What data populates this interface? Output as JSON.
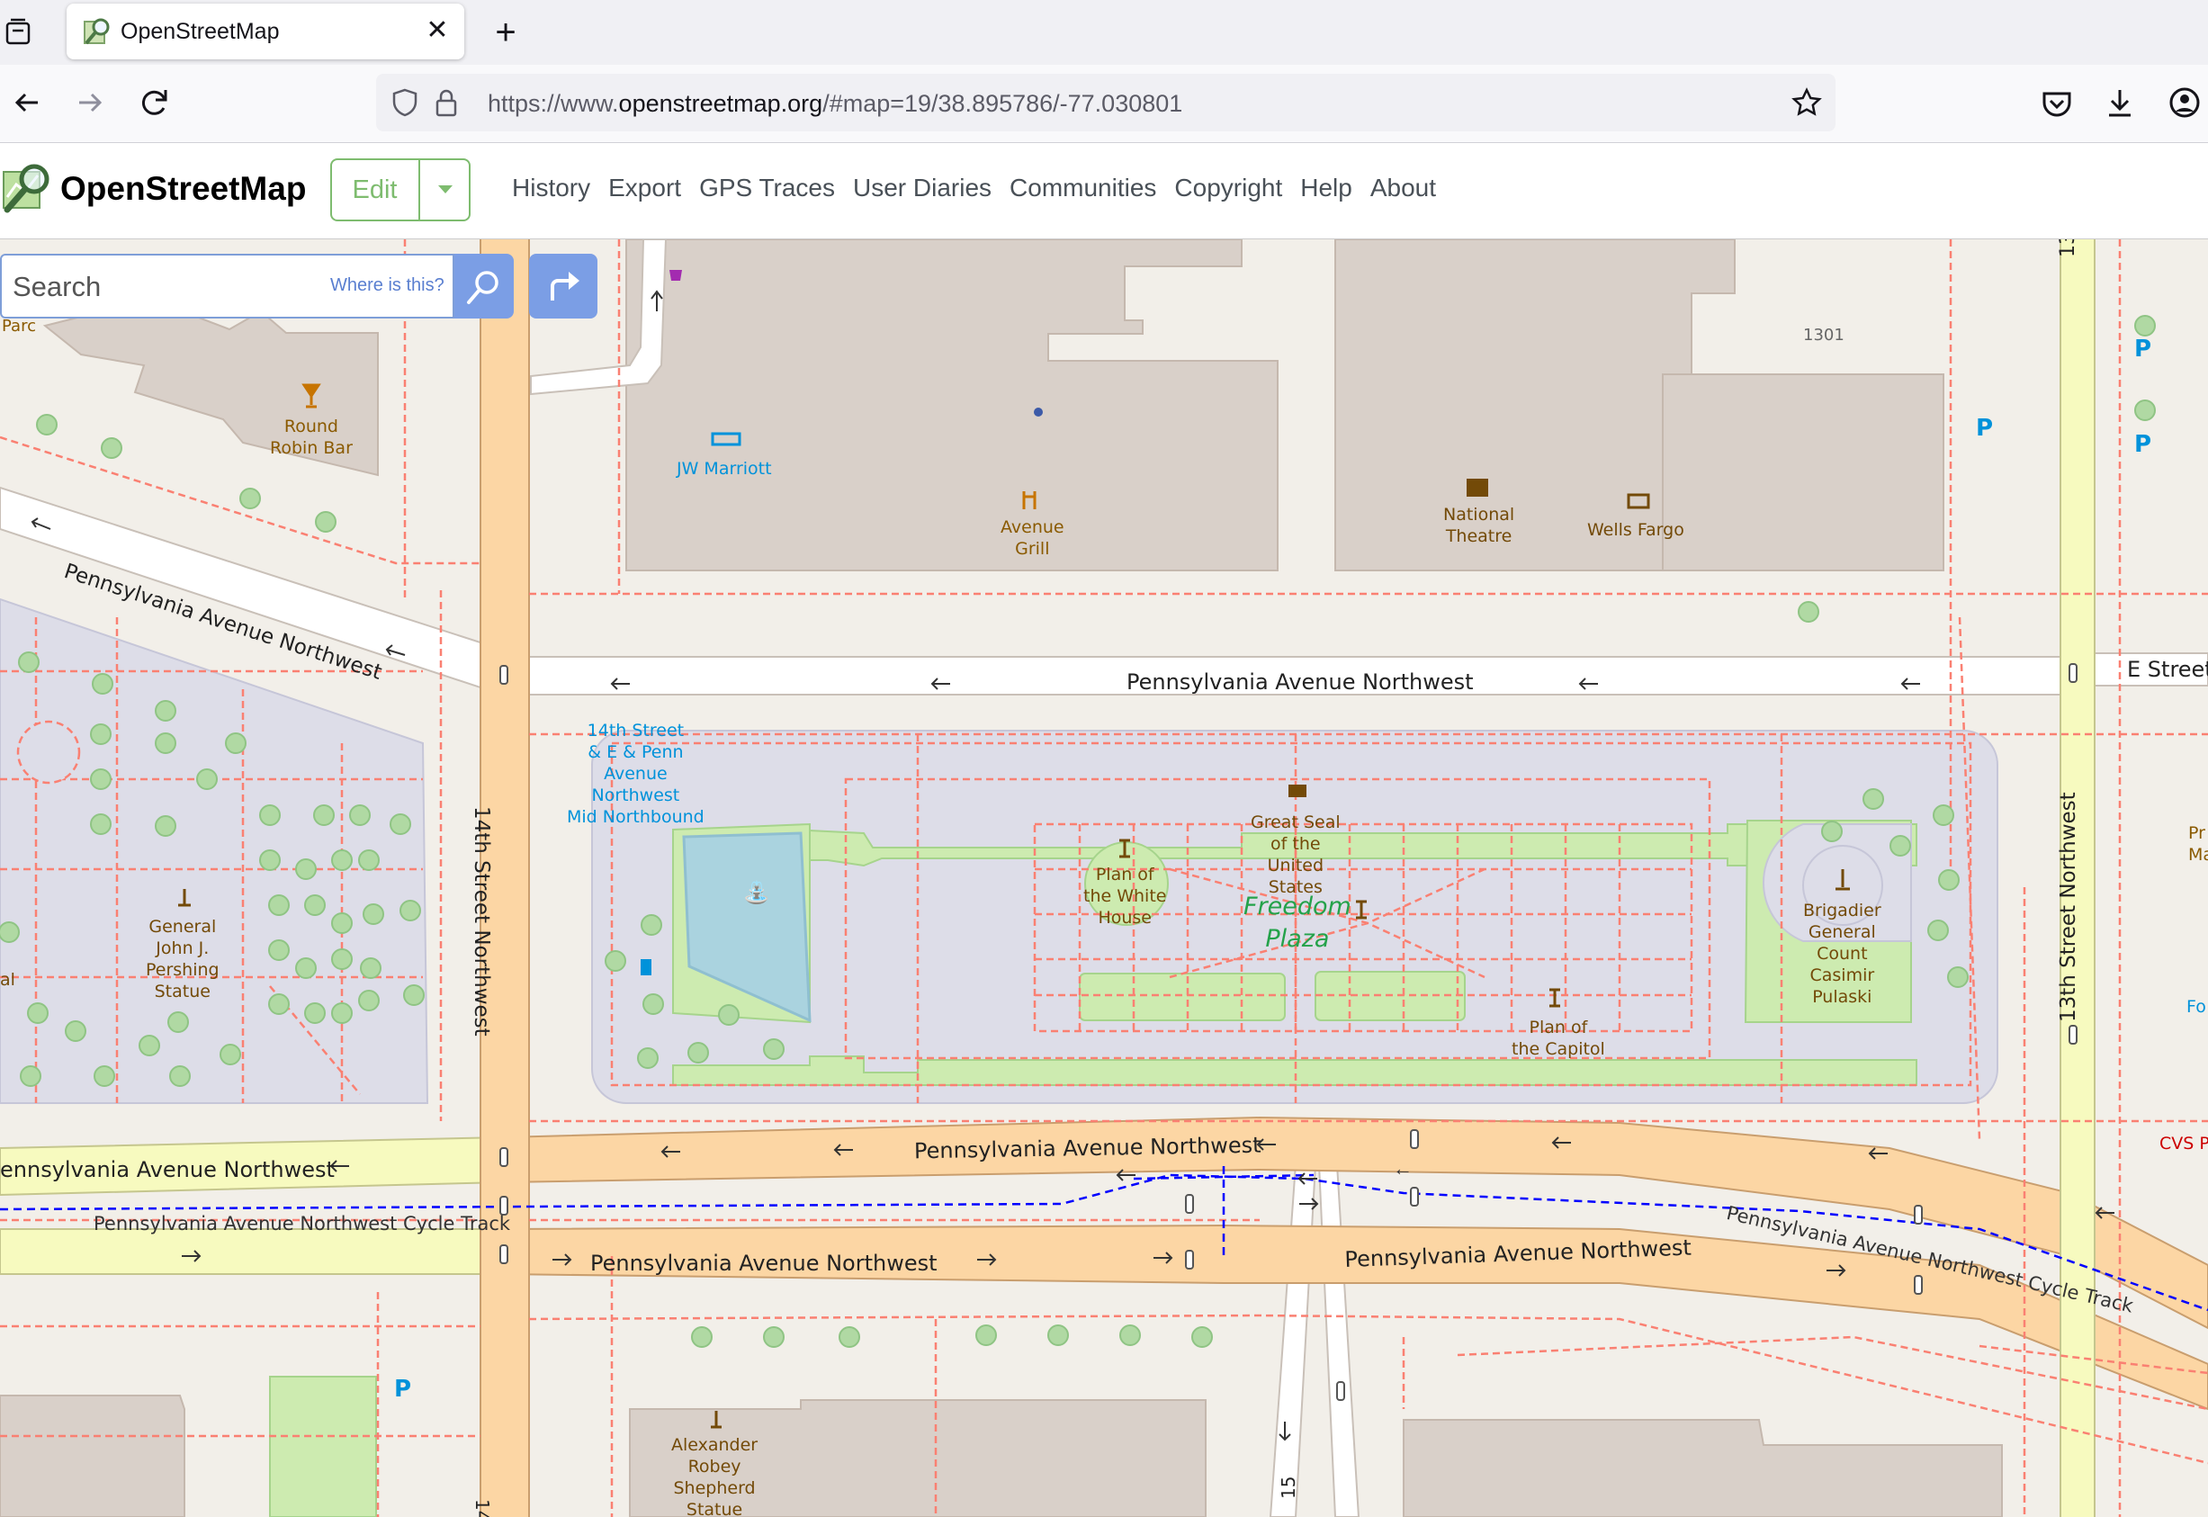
{
  "browser": {
    "tab_title": "OpenStreetMap",
    "url_prefix": "https://www.",
    "url_host": "openstreetmap.org",
    "url_path": "/#map=19/38.895786/-77.030801"
  },
  "header": {
    "site_title": "OpenStreetMap",
    "edit_label": "Edit",
    "nav": [
      "History",
      "Export",
      "GPS Traces",
      "User Diaries",
      "Communities",
      "Copyright",
      "Help",
      "About"
    ]
  },
  "search": {
    "placeholder": "Search",
    "where_label": "Where is this?"
  },
  "map": {
    "streets": {
      "penn_top_left": "Pennsylvania Avenue Northwest",
      "penn_top": "Pennsylvania Avenue Northwest",
      "e_street": "E Street",
      "penn_mid_left": "ennsylvania Avenue Northwest",
      "penn_mid": "Pennsylvania Avenue Northwest",
      "cycle_left": "Pennsylvania Avenue Northwest Cycle Track",
      "penn_low_left": "Pennsylvania Avenue Northwest",
      "penn_low_right": "Pennsylvania Avenue Northwest",
      "cycle_right": "Pennsylvania Avenue Northwest Cycle Track",
      "fourteenth": "14th Street Northwest",
      "thirteenth": "13th Street Northwest",
      "thirteenth_top": "13",
      "fourteenth_bottom": "14",
      "fifteenth_bottom": "15"
    },
    "pois": {
      "round_robin": "Round\nRobin Bar",
      "jw_marriott": "JW Marriott",
      "avenue_grill": "Avenue\nGrill",
      "national_theatre": "National\nTheatre",
      "wells_fargo": "Wells Fargo",
      "address_1301": "1301",
      "bus_stop": "14th Street\n& E & Penn\nAvenue\nNorthwest\nMid Northbound",
      "great_seal": "Great Seal\nof the\nUnited\nStates",
      "plan_white_house": "Plan of\nthe White\nHouse",
      "freedom_plaza": "Freedom\nPlaza",
      "plan_capitol": "Plan of\nthe Capitol",
      "pulaski": "Brigadier\nGeneral\nCount\nCasimir\nPulaski",
      "pershing": "General\nJohn J.\nPershing\nStatue",
      "shepherd": "Alexander\nRobey\nShepherd\nStatue",
      "cvs": "CVS P",
      "parc": "Parc",
      "al": "al",
      "pr_ma": "Pr\nMa",
      "fo": "Fo"
    }
  },
  "colors": {
    "accent_green": "#7ebc6f",
    "search_blue": "#7b9ee5",
    "primary_road": "#fcd6a4",
    "secondary_road": "#f7fabf",
    "building": "#d9d0c9",
    "pedestrian": "#dddde8"
  }
}
